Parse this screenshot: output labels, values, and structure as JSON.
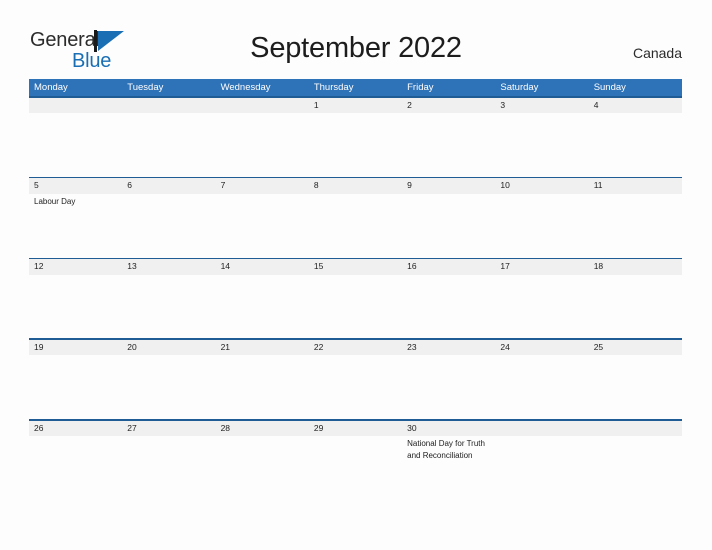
{
  "brand": {
    "name_part1": "General",
    "name_part2": "Blue",
    "mark": "blue-triangle-logo-icon"
  },
  "header": {
    "title": "September 2022",
    "country": "Canada"
  },
  "colors": {
    "header_blue": "#2e72b8",
    "rule_blue": "#1f5c96",
    "band_gray": "#f0f0f0",
    "brand_blue": "#1a6fb4",
    "page_background": "#fdfdfd",
    "text": "#222222"
  },
  "calendar": {
    "weekday_headers": [
      "Monday",
      "Tuesday",
      "Wednesday",
      "Thursday",
      "Friday",
      "Saturday",
      "Sunday"
    ],
    "weeks": [
      [
        {
          "date": "",
          "event": ""
        },
        {
          "date": "",
          "event": ""
        },
        {
          "date": "",
          "event": ""
        },
        {
          "date": "1",
          "event": ""
        },
        {
          "date": "2",
          "event": ""
        },
        {
          "date": "3",
          "event": ""
        },
        {
          "date": "4",
          "event": ""
        }
      ],
      [
        {
          "date": "5",
          "event": "Labour Day"
        },
        {
          "date": "6",
          "event": ""
        },
        {
          "date": "7",
          "event": ""
        },
        {
          "date": "8",
          "event": ""
        },
        {
          "date": "9",
          "event": ""
        },
        {
          "date": "10",
          "event": ""
        },
        {
          "date": "11",
          "event": ""
        }
      ],
      [
        {
          "date": "12",
          "event": ""
        },
        {
          "date": "13",
          "event": ""
        },
        {
          "date": "14",
          "event": ""
        },
        {
          "date": "15",
          "event": ""
        },
        {
          "date": "16",
          "event": ""
        },
        {
          "date": "17",
          "event": ""
        },
        {
          "date": "18",
          "event": ""
        }
      ],
      [
        {
          "date": "19",
          "event": ""
        },
        {
          "date": "20",
          "event": ""
        },
        {
          "date": "21",
          "event": ""
        },
        {
          "date": "22",
          "event": ""
        },
        {
          "date": "23",
          "event": ""
        },
        {
          "date": "24",
          "event": ""
        },
        {
          "date": "25",
          "event": ""
        }
      ],
      [
        {
          "date": "26",
          "event": ""
        },
        {
          "date": "27",
          "event": ""
        },
        {
          "date": "28",
          "event": ""
        },
        {
          "date": "29",
          "event": ""
        },
        {
          "date": "30",
          "event": "National Day for Truth and Reconciliation"
        },
        {
          "date": "",
          "event": ""
        },
        {
          "date": "",
          "event": ""
        }
      ]
    ]
  }
}
